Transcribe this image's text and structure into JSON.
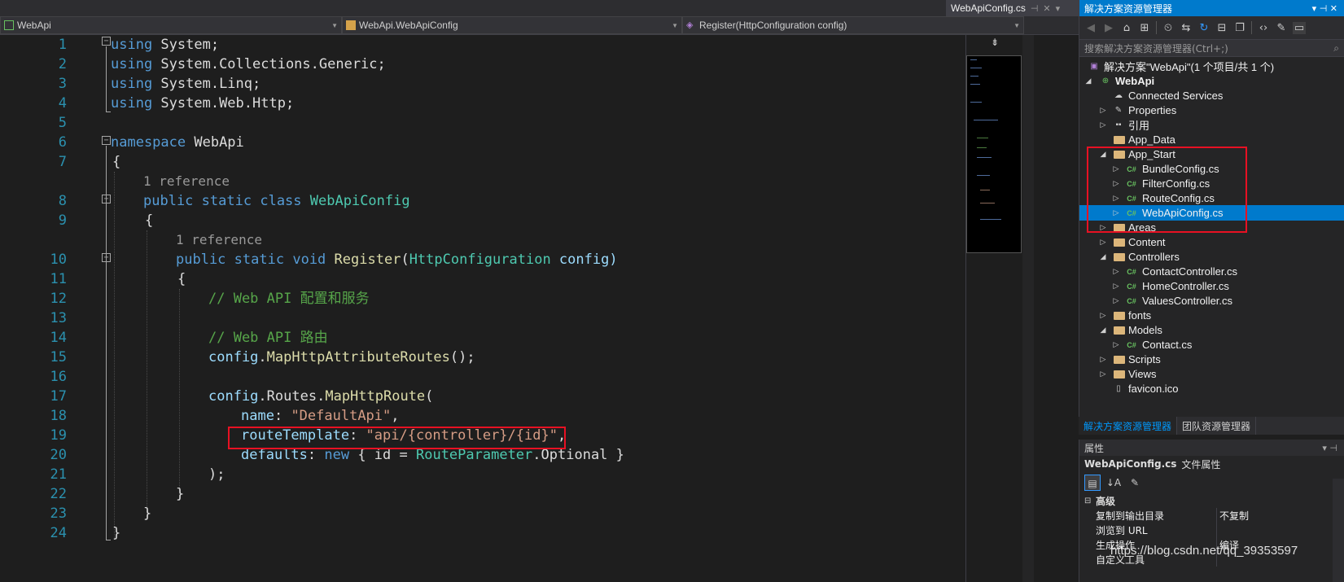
{
  "editor": {
    "tab_title": "WebApiConfig.cs",
    "nav": {
      "project": "WebApi",
      "class": "WebApi.WebApiConfig",
      "member": "Register(HttpConfiguration config)"
    },
    "line_numbers": [
      "1",
      "2",
      "3",
      "4",
      "5",
      "6",
      "7",
      "8",
      "9",
      "10",
      "11",
      "12",
      "13",
      "14",
      "15",
      "16",
      "17",
      "18",
      "19",
      "20",
      "21",
      "22",
      "23",
      "24"
    ],
    "codelens": {
      "class_ref": "1 reference",
      "method_ref": "1 reference"
    },
    "code": {
      "l1_kw": "using",
      "l1_rest": " System;",
      "l2_kw": "using",
      "l2_rest": " System.Collections.Generic;",
      "l3_kw": "using",
      "l3_rest": " System.Linq;",
      "l4_kw": "using",
      "l4_rest": " System.Web.Http;",
      "l6_kw": "namespace",
      "l6_rest": " WebApi",
      "l7": "{",
      "l8_kw1": "public",
      "l8_kw2": "static",
      "l8_kw3": "class",
      "l8_type": "WebApiConfig",
      "l9": "{",
      "l10_kw1": "public",
      "l10_kw2": "static",
      "l10_kw3": "void",
      "l10_fn": "Register",
      "l10_p1": "(",
      "l10_type": "HttpConfiguration",
      "l10_p2": " config)",
      "l11": "{",
      "l12": "// Web API 配置和服务",
      "l14": "// Web API 路由",
      "l15_a": "config",
      "l15_b": ".",
      "l15_fn": "MapHttpAttributeRoutes",
      "l15_c": "();",
      "l17_a": "config",
      "l17_b": ".",
      "l17_c": "Routes",
      "l17_d": ".",
      "l17_fn": "MapHttpRoute",
      "l17_e": "(",
      "l18_p": "name",
      "l18_c": ": ",
      "l18_s": "\"DefaultApi\"",
      "l18_e": ",",
      "l19_p": "routeTemplate",
      "l19_c": ": ",
      "l19_s": "\"api/{controller}/{id}\"",
      "l19_e": ",",
      "l20_p": "defaults",
      "l20_c": ": ",
      "l20_kw": "new",
      "l20_a": " { id = ",
      "l20_type": "RouteParameter",
      "l20_b": ".",
      "l20_d": "Optional",
      "l20_e": " }",
      "l21": ");",
      "l22": "}",
      "l23": "}",
      "l24": "}"
    }
  },
  "solution_explorer": {
    "title": "解决方案资源管理器",
    "search_placeholder": "搜索解决方案资源管理器(Ctrl+;)",
    "items": [
      {
        "label": "解决方案\"WebApi\"(1 个项目/共 1 个)",
        "icon": "solution-icon"
      },
      {
        "label": "WebApi",
        "icon": "project-icon"
      },
      {
        "label": "Connected Services",
        "icon": "connected-services-icon"
      },
      {
        "label": "Properties",
        "icon": "wrench-icon"
      },
      {
        "label": "引用",
        "icon": "references-icon"
      },
      {
        "label": "App_Data",
        "icon": "folder-icon"
      },
      {
        "label": "App_Start",
        "icon": "folder-open-icon"
      },
      {
        "label": "BundleConfig.cs",
        "icon": "csharp-file-icon"
      },
      {
        "label": "FilterConfig.cs",
        "icon": "csharp-file-icon"
      },
      {
        "label": "RouteConfig.cs",
        "icon": "csharp-file-icon"
      },
      {
        "label": "WebApiConfig.cs",
        "icon": "csharp-file-icon"
      },
      {
        "label": "Areas",
        "icon": "folder-icon"
      },
      {
        "label": "Content",
        "icon": "folder-icon"
      },
      {
        "label": "Controllers",
        "icon": "folder-open-icon"
      },
      {
        "label": "ContactController.cs",
        "icon": "csharp-file-icon"
      },
      {
        "label": "HomeController.cs",
        "icon": "csharp-file-icon"
      },
      {
        "label": "ValuesController.cs",
        "icon": "csharp-file-icon"
      },
      {
        "label": "fonts",
        "icon": "folder-icon"
      },
      {
        "label": "Models",
        "icon": "folder-open-icon"
      },
      {
        "label": "Contact.cs",
        "icon": "csharp-file-icon"
      },
      {
        "label": "Scripts",
        "icon": "folder-icon"
      },
      {
        "label": "Views",
        "icon": "folder-icon"
      },
      {
        "label": "favicon.ico",
        "icon": "file-icon"
      }
    ],
    "selected": "WebApiConfig.cs",
    "bottom_tabs": [
      "解决方案资源管理器",
      "团队资源管理器"
    ]
  },
  "properties": {
    "title": "属性",
    "object_name": "WebApiConfig.cs",
    "object_type": "文件属性",
    "category": "高级",
    "rows": [
      {
        "key": "复制到输出目录",
        "value": "不复制"
      },
      {
        "key": "浏览到 URL",
        "value": ""
      },
      {
        "key": "生成操作",
        "value": "编译"
      },
      {
        "key": "自定义工具",
        "value": ""
      }
    ]
  },
  "watermark": "https://blog.csdn.net/qq_39353597",
  "colors": {
    "accent": "#007acc",
    "highlight_box": "#e81123",
    "keyword": "#569cd6",
    "type": "#4ec9b0",
    "comment": "#57a64a",
    "string": "#d69d85"
  }
}
